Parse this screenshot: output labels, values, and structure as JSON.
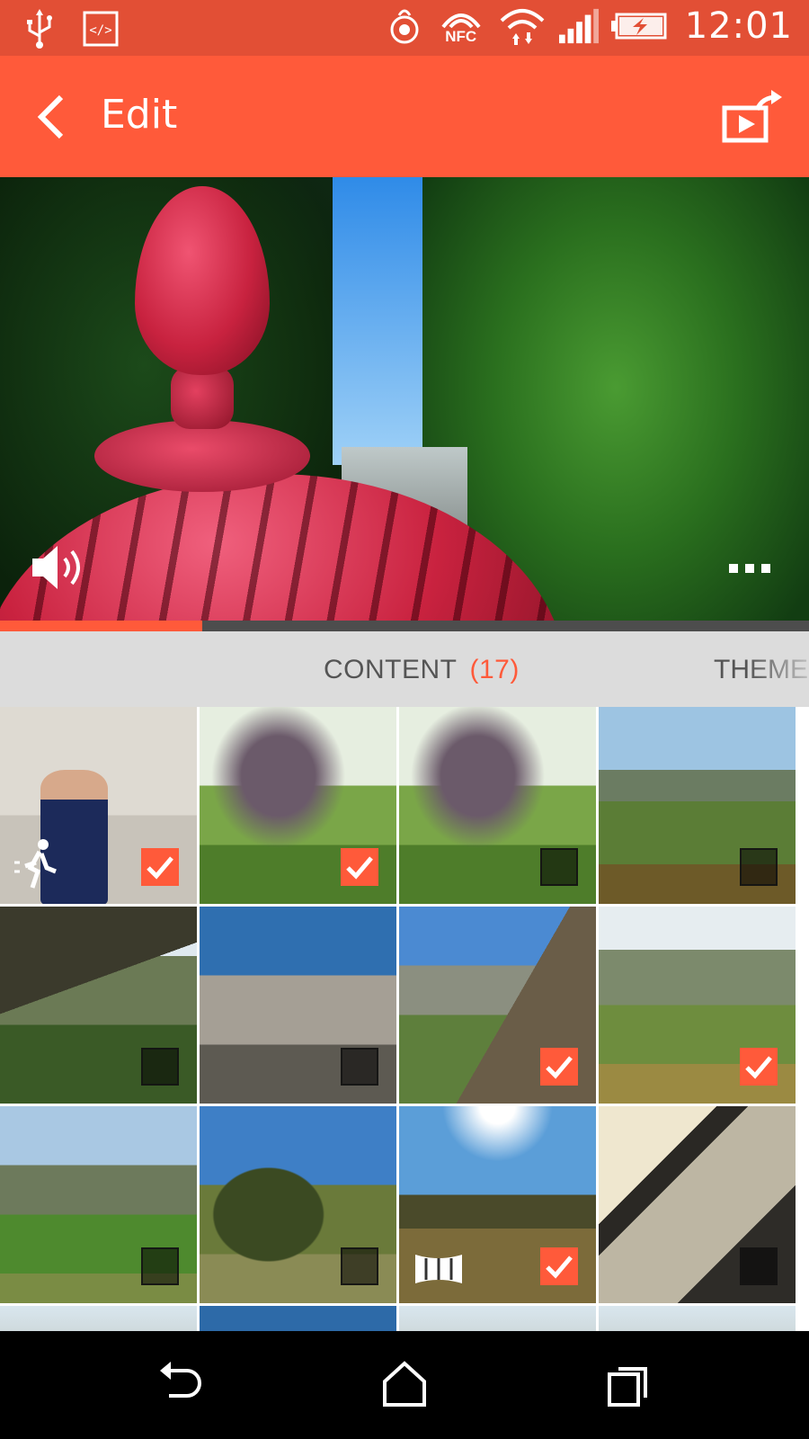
{
  "status_bar": {
    "time": "12:01",
    "nfc_label": "NFC",
    "icons": [
      "usb-icon",
      "developer-mode-icon",
      "htc-sense-icon",
      "nfc-icon",
      "wifi-icon",
      "signal-icon",
      "battery-charging-icon"
    ]
  },
  "app_bar": {
    "title": "Edit",
    "back_icon": "chevron-left-icon",
    "share_icon": "share-video-icon"
  },
  "preview": {
    "volume_icon": "volume-icon",
    "more_icon": "more-horizontal-icon",
    "progress_fraction": 0.25
  },
  "tabs": {
    "content_label": "CONTENT",
    "content_count": "(17)",
    "themes_label": "THEMES"
  },
  "grid": {
    "items": [
      {
        "scene": "person indoors",
        "checked": true,
        "badge": "zoe-motion-icon"
      },
      {
        "scene": "tree in park",
        "checked": true
      },
      {
        "scene": "tree in park",
        "checked": false
      },
      {
        "scene": "city panorama",
        "checked": false
      },
      {
        "scene": "crags",
        "checked": false
      },
      {
        "scene": "city rooftops",
        "checked": false
      },
      {
        "scene": "rock and city",
        "checked": true
      },
      {
        "scene": "hillside city",
        "checked": true
      },
      {
        "scene": "park and city",
        "checked": false
      },
      {
        "scene": "arthurs seat",
        "checked": false
      },
      {
        "scene": "sunlit hill",
        "checked": true,
        "badge": "panorama-icon"
      },
      {
        "scene": "rock face",
        "checked": false
      }
    ]
  },
  "nav_bar": {
    "icons": [
      "back-nav-icon",
      "home-nav-icon",
      "recents-nav-icon"
    ]
  },
  "colors": {
    "status_bar": "#e24f35",
    "accent": "#ff5a3a",
    "tab_bar": "#dcdcdc"
  }
}
